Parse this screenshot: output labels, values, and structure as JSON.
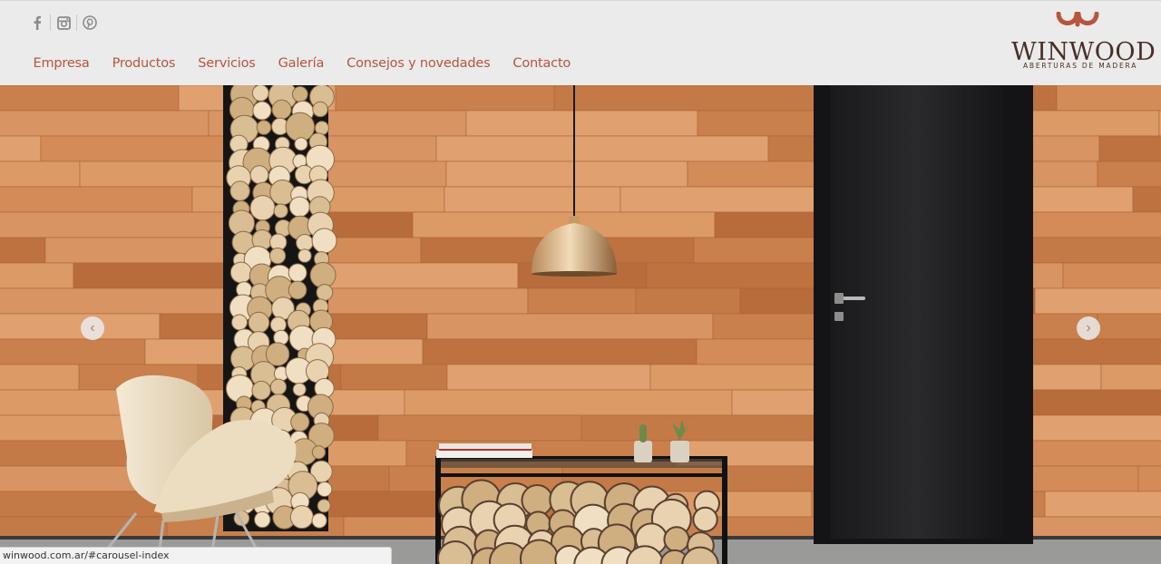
{
  "social": [
    {
      "name": "facebook-icon"
    },
    {
      "name": "instagram-icon"
    },
    {
      "name": "pinterest-icon"
    }
  ],
  "nav": {
    "items": [
      {
        "label": "Empresa"
      },
      {
        "label": "Productos"
      },
      {
        "label": "Servicios"
      },
      {
        "label": "Galería"
      },
      {
        "label": "Consejos y novedades"
      },
      {
        "label": "Contacto"
      }
    ]
  },
  "logo": {
    "wordmark": "WINWOOD",
    "tagline": "ABERTURAS DE MADERA"
  },
  "carousel": {
    "prev_label": "‹",
    "next_label": "›"
  },
  "status_bar": {
    "url": "winwood.com.ar/#carousel-index"
  },
  "colors": {
    "accent": "#b8553c",
    "brand_dark": "#4a2e25",
    "header_bg": "#ebebeb"
  }
}
